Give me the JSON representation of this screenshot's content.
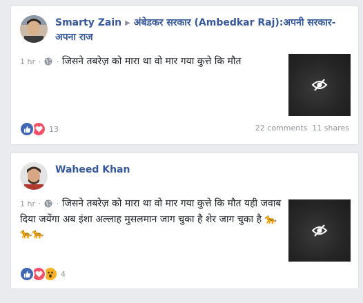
{
  "posts": [
    {
      "author": "Smarty Zain",
      "group": "अंबेडकर सरकार (Ambedkar Raj):अपनी सरकार-अपना राज",
      "time": "1 hr",
      "privacy_icon": "globe-icon",
      "text": "जिसने तबरेज़ को मारा था वो मार गया कुत्ते कि मौत",
      "media_icon": "eye-slash-icon",
      "reactions": [
        "like",
        "love"
      ],
      "reaction_count": "13",
      "comments": "22 comments",
      "shares": "11 shares"
    },
    {
      "author": "Waheed Khan",
      "time": "1 hr",
      "privacy_icon": "globe-icon",
      "text": "जिसने तबरेज़ को मारा था वो मार गया कुत्ते कि मौत यही जवाब दिया जयेंगा अब इंशा अल्लाह मुसलमान जाग चुका है शेर जाग चुका है 🐆🐆🐆",
      "media_icon": "eye-slash-icon",
      "reactions": [
        "like",
        "love",
        "wow"
      ],
      "reaction_count": "4"
    }
  ],
  "colors": {
    "link": "#365899",
    "meta": "#90949c",
    "like": "#4267b2",
    "love": "#f25268",
    "wow": "#f7b125",
    "background": "#e9ebee"
  }
}
